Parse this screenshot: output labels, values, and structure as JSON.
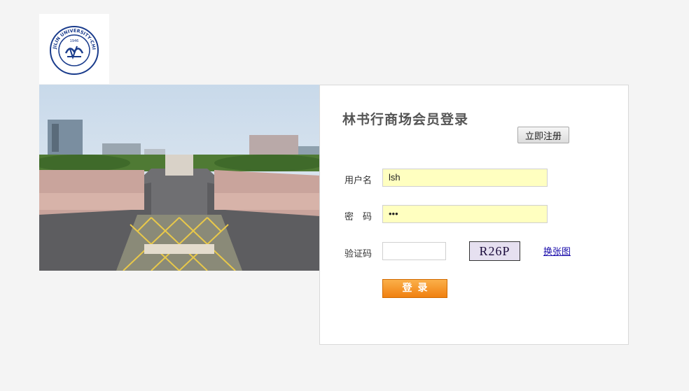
{
  "logo": {
    "ring_text": "JILIN UNIVERSITY·CHINA",
    "year": "1946",
    "chinese_seal": "吉林大学"
  },
  "login": {
    "title": "林书行商场会员登录",
    "register_label": "立即注册",
    "username_label": "用户名",
    "username_value": "lsh",
    "password_label": "密　码",
    "password_value": "•••",
    "captcha_label": "验证码",
    "captcha_value": "",
    "captcha_text": "R26P",
    "refresh_label": "换张图",
    "submit_label": "登录"
  }
}
